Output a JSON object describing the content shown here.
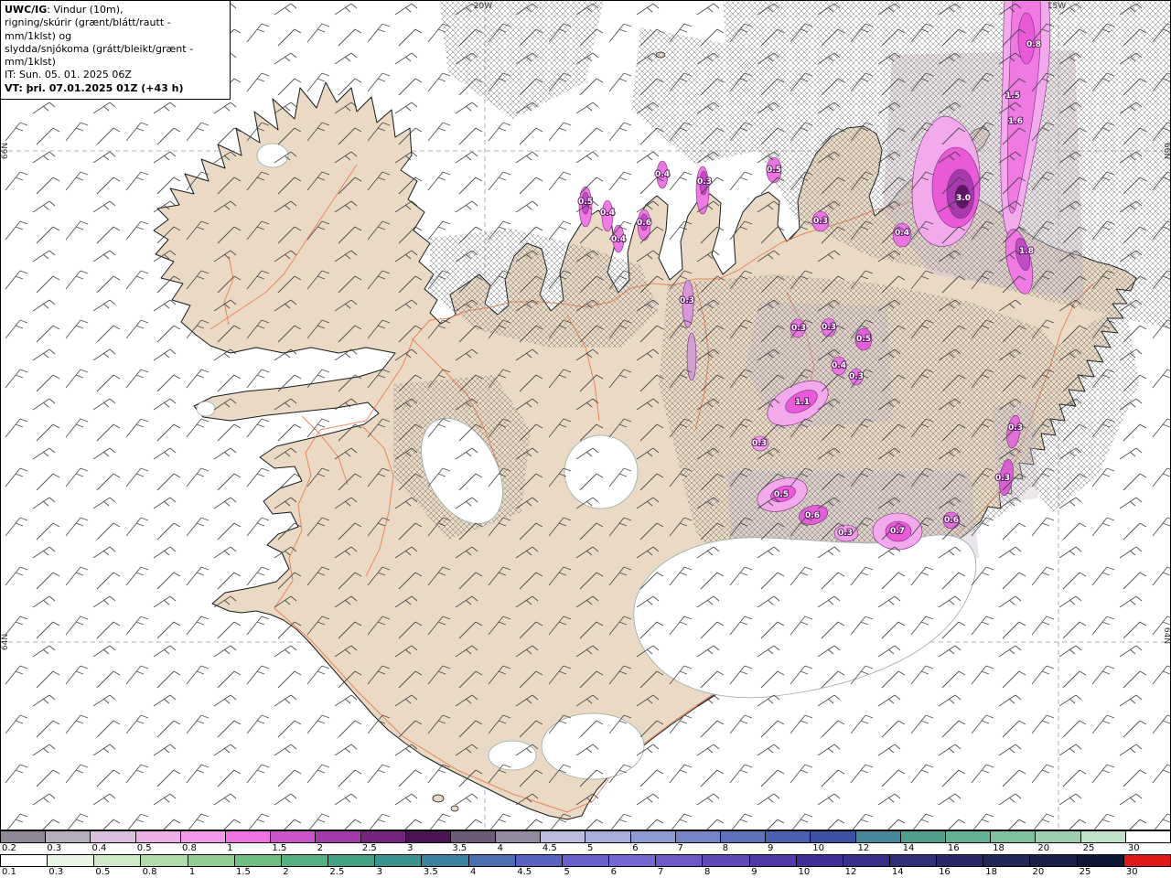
{
  "header": {
    "model": "UWC/IG",
    "line1_rest": ": Vindur (10m),",
    "line2": "rigning/skúrir (grænt/blátt/rautt - mm/1klst) og",
    "line3": "slydda/snjókoma (grátt/bleikt/grænt - mm/1klst)",
    "init_time": "IT: Sun. 05. 01. 2025 06Z",
    "valid_time": "VT: þri. 07.01.2025 01Z (+43 h)"
  },
  "graticule": {
    "lon_20w": "20W",
    "lon_15w": "15W",
    "lat_66n": "66N",
    "lat_64n": "64N"
  },
  "map": {
    "land_color": "#ead9c5",
    "sea_color": "#ffffff",
    "road_color": "#e8784a",
    "precip_labels": [
      "0.5",
      "0.4",
      "0.4",
      "0.6",
      "0.4",
      "0.3",
      "0.5",
      "0.3",
      "0.4",
      "3.0",
      "0.8",
      "1.5",
      "1.6",
      "1.8",
      "0.3",
      "0.3",
      "0.3",
      "0.5",
      "0.4",
      "0.3",
      "1.1",
      "0.3",
      "0.3",
      "0.3",
      "0.5",
      "0.6",
      "0.3",
      "0.7",
      "0.6"
    ]
  },
  "scales": {
    "sleet_snow": {
      "values": [
        "0.2",
        "0.3",
        "0.4",
        "0.5",
        "0.8",
        "1",
        "1.5",
        "2",
        "2.5",
        "3",
        "3.5",
        "4",
        "4.5",
        "5",
        "6",
        "7",
        "8",
        "9",
        "10",
        "12",
        "14",
        "16",
        "18",
        "20",
        "25",
        "30"
      ],
      "colors": [
        "#8f8798",
        "#b6aebc",
        "#dbc0de",
        "#edafe8",
        "#f29ae9",
        "#ee72e2",
        "#cc55cc",
        "#a23aaa",
        "#76257f",
        "#4c1356",
        "#6c5a76",
        "#948aa0",
        "#bcbce0",
        "#a6aeda",
        "#8e9ad2",
        "#7685c8",
        "#5f71bd",
        "#4c60b0",
        "#3d51a2",
        "#47879b",
        "#4f9f8f",
        "#63b193",
        "#7fc09d",
        "#9ccfae",
        "#c2e2c8",
        "#ffffff"
      ]
    },
    "rain": {
      "values": [
        "0.1",
        "0.3",
        "0.5",
        "0.8",
        "1",
        "1.5",
        "2",
        "2.5",
        "3",
        "3.5",
        "4",
        "4.5",
        "5",
        "6",
        "7",
        "8",
        "9",
        "10",
        "12",
        "14",
        "16",
        "18",
        "20",
        "25",
        "30"
      ],
      "colors": [
        "#ffffff",
        "#e9f6e3",
        "#cfeac6",
        "#b0dcab",
        "#90cd92",
        "#6fbe80",
        "#54b07e",
        "#44a284",
        "#3a948f",
        "#3a829f",
        "#4a70b2",
        "#5a64c0",
        "#6a60cc",
        "#7668d2",
        "#6f58c8",
        "#6048b8",
        "#5038a8",
        "#403098",
        "#383088",
        "#303078",
        "#282868",
        "#202858",
        "#182048",
        "#101838",
        "#e01818"
      ]
    }
  }
}
